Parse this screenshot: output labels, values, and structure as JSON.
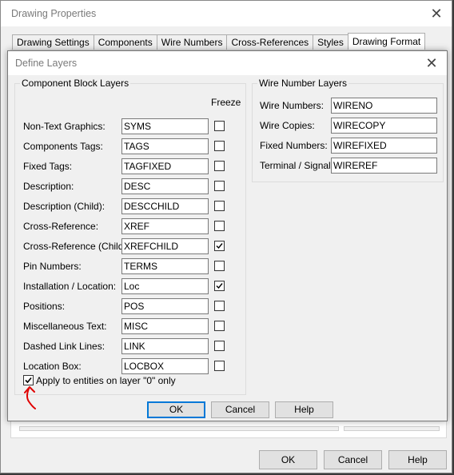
{
  "outer": {
    "title": "Drawing Properties",
    "tabs": [
      "Drawing Settings",
      "Components",
      "Wire Numbers",
      "Cross-References",
      "Styles",
      "Drawing Format"
    ],
    "active_tab": 5,
    "buttons": {
      "ok": "OK",
      "cancel": "Cancel",
      "help": "Help"
    }
  },
  "dialog": {
    "title": "Define Layers",
    "component_group": {
      "legend": "Component Block Layers",
      "freeze_label": "Freeze",
      "rows": [
        {
          "label": "Non-Text Graphics:",
          "value": "SYMS",
          "freeze": false
        },
        {
          "label": "Components Tags:",
          "value": "TAGS",
          "freeze": false
        },
        {
          "label": "Fixed Tags:",
          "value": "TAGFIXED",
          "freeze": false
        },
        {
          "label": "Description:",
          "value": "DESC",
          "freeze": false
        },
        {
          "label": "Description (Child):",
          "value": "DESCCHILD",
          "freeze": false
        },
        {
          "label": "Cross-Reference:",
          "value": "XREF",
          "freeze": false
        },
        {
          "label": "Cross-Reference (Child):",
          "value": "XREFCHILD",
          "freeze": true
        },
        {
          "label": "Pin Numbers:",
          "value": "TERMS",
          "freeze": false
        },
        {
          "label": "Installation / Location:",
          "value": "Loc",
          "freeze": true
        },
        {
          "label": "Positions:",
          "value": "POS",
          "freeze": false
        },
        {
          "label": "Miscellaneous Text:",
          "value": "MISC",
          "freeze": false
        },
        {
          "label": "Dashed Link Lines:",
          "value": "LINK",
          "freeze": false
        },
        {
          "label": "Location Box:",
          "value": "LOCBOX",
          "freeze": false
        }
      ],
      "apply_label": "Apply to entities on layer \"0\" only",
      "apply_checked": true
    },
    "wire_group": {
      "legend": "Wire Number Layers",
      "rows": [
        {
          "label": "Wire Numbers:",
          "value": "WIRENO"
        },
        {
          "label": "Wire Copies:",
          "value": "WIRECOPY"
        },
        {
          "label": "Fixed Numbers:",
          "value": "WIREFIXED"
        },
        {
          "label": "Terminal / Signal:",
          "value": "WIREREF"
        }
      ]
    },
    "buttons": {
      "ok": "OK",
      "cancel": "Cancel",
      "help": "Help"
    }
  },
  "colors": {
    "focus_border": "#0078d7",
    "annotation": "#e00000"
  }
}
